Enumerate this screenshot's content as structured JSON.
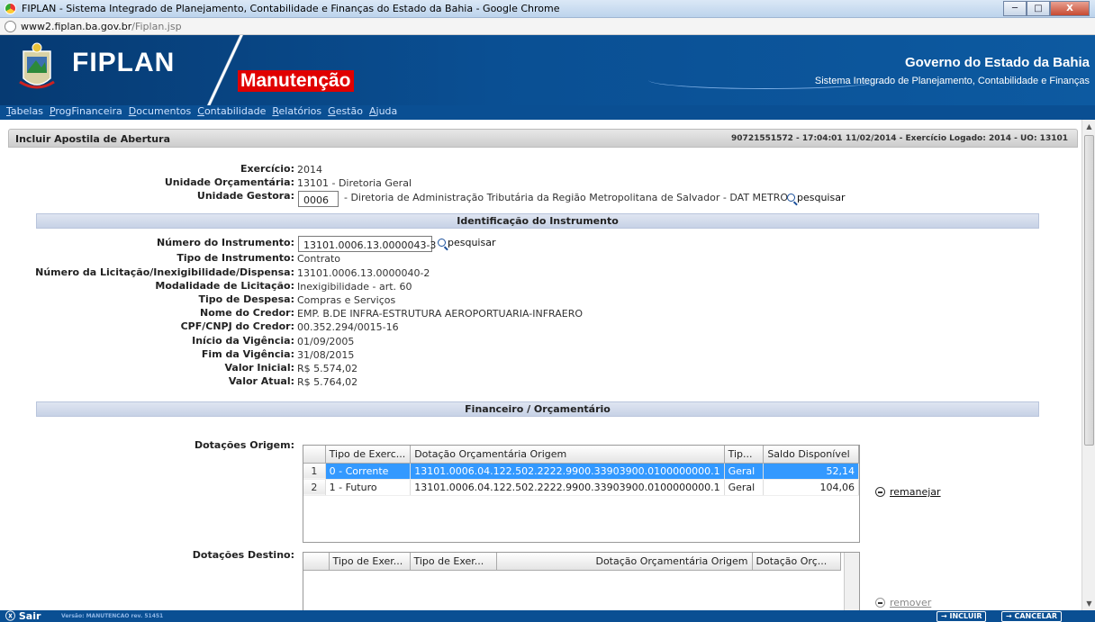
{
  "window": {
    "title": "FIPLAN - Sistema Integrado de Planejamento, Contabilidade e Finanças do Estado da Bahia - Google Chrome",
    "url_host": "www2.fiplan.ba.gov.br",
    "url_path": "/Fiplan.jsp",
    "min_label": "─",
    "max_label": "□",
    "close_label": "X"
  },
  "header": {
    "brand": "FIPLAN",
    "module": "Manutenção",
    "gov": "Governo do Estado da Bahia",
    "system": "Sistema Integrado de Planejamento, Contabilidade e Finanças"
  },
  "menu": [
    "Tabelas",
    "ProgFinanceira",
    "Documentos",
    "Contabilidade",
    "Relatórios",
    "Gestão",
    "Ajuda"
  ],
  "panel": {
    "title": "Incluir Apostila de Abertura",
    "info": "90721551572 - 17:04:01 11/02/2014 - Exercício Logado: 2014 - UO: 13101"
  },
  "top_fields": {
    "exercicio_label": "Exercício:",
    "exercicio": "2014",
    "uo_label": "Unidade Orçamentária:",
    "uo": "13101 - Diretoria Geral",
    "ug_label": "Unidade Gestora:",
    "ug_code": "0006",
    "ug_desc": "- Diretoria de Administração Tributária da Região Metropolitana de Salvador - DAT METRO",
    "pesquisar": "pesquisar"
  },
  "section_ident": "Identificação do Instrumento",
  "instrumento": {
    "numero_label": "Número do Instrumento:",
    "numero": "13101.0006.13.0000043-3",
    "pesquisar": "pesquisar",
    "rows": [
      {
        "label": "Tipo de Instrumento:",
        "value": "Contrato"
      },
      {
        "label": "Número da Licitação/Inexigibilidade/Dispensa:",
        "value": "13101.0006.13.0000040-2"
      },
      {
        "label": "Modalidade de Licitação:",
        "value": "Inexigibilidade - art. 60"
      },
      {
        "label": "Tipo de Despesa:",
        "value": "Compras e Serviços"
      },
      {
        "label": "Nome do Credor:",
        "value": "EMP. B.DE INFRA-ESTRUTURA AEROPORTUARIA-INFRAERO"
      },
      {
        "label": "CPF/CNPJ do Credor:",
        "value": "00.352.294/0015-16"
      },
      {
        "label": "Início da Vigência:",
        "value": "01/09/2005"
      },
      {
        "label": "Fim da Vigência:",
        "value": "31/08/2015"
      },
      {
        "label": "Valor Inicial:",
        "value": "R$ 5.574,02"
      },
      {
        "label": "Valor Atual:",
        "value": "R$ 5.764,02"
      }
    ]
  },
  "section_fin": "Financeiro / Orçamentário",
  "origem": {
    "label": "Dotações Origem:",
    "headers": [
      "Tipo de Exerc...",
      "Dotação Orçamentária Origem",
      "Tip...",
      "Saldo Disponível"
    ],
    "rows": [
      {
        "n": "1",
        "tipo": "0 - Corrente",
        "dotacao": "13101.0006.04.122.502.2222.9900.33903900.0100000000.1",
        "tp": "Geral",
        "saldo": "52,14"
      },
      {
        "n": "2",
        "tipo": "1 - Futuro",
        "dotacao": "13101.0006.04.122.502.2222.9900.33903900.0100000000.1",
        "tp": "Geral",
        "saldo": "104,06"
      }
    ],
    "action": "remanejar"
  },
  "destino": {
    "label": "Dotações Destino:",
    "headers": [
      "Tipo de Exer...",
      "Tipo de Exer...",
      "Dotação Orçamentária Origem",
      "Dotação Orç..."
    ],
    "action": "remover"
  },
  "footer": {
    "sair": "Sair",
    "versao": "Versão: MANUTENCAO rev. 51451",
    "incluir": "→ INCLUIR",
    "cancelar": "→ CANCELAR"
  }
}
